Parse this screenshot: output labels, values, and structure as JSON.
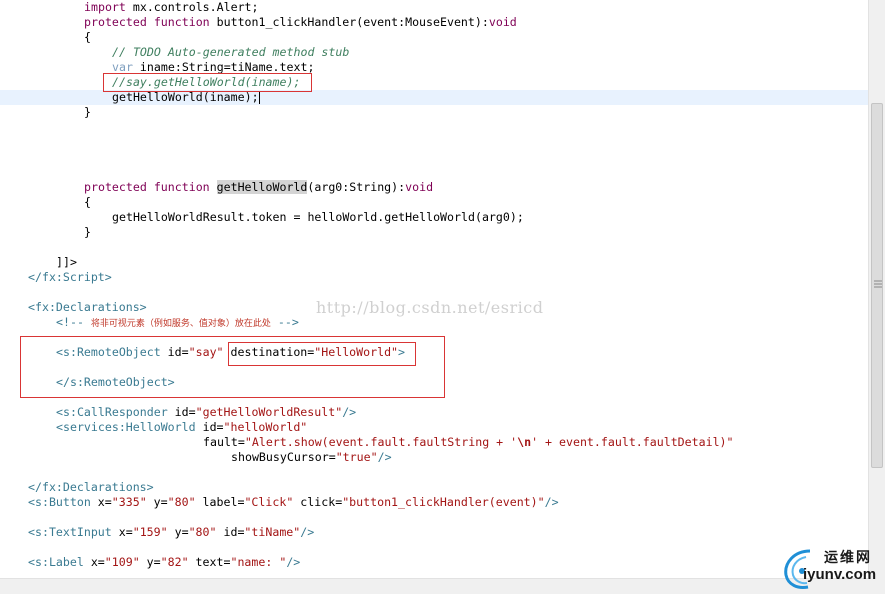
{
  "code": {
    "l1": {
      "kw": "import",
      "rest": " mx.controls.Alert;"
    },
    "l2": {
      "kw1": "protected",
      "kw2": "function",
      "rest": " button1_clickHandler(event:MouseEvent):",
      "ret": "void"
    },
    "l3": "{",
    "l4": "// TODO Auto-generated method stub",
    "l5": {
      "kw": "var",
      "rest": " iname:String=tiName.text;"
    },
    "l6": "//say.getHelloWorld(iname);",
    "l7": "getHelloWorld(iname);",
    "l8": "}",
    "l9": {
      "kw1": "protected",
      "kw2": "function",
      "fn": "getHelloWorld",
      "rest": "(arg0:String):",
      "ret": "void"
    },
    "l10": "{",
    "l11": "getHelloWorldResult.token = helloWorld.getHelloWorld(arg0);",
    "l12": "}",
    "l13": "]]>",
    "l14": "</fx:Script>",
    "l15": "<fx:Declarations>",
    "l16": {
      "open": "<!-- ",
      "text": "将非可视元素（例如服务、值对象）放在此处",
      "close": " -->"
    },
    "l17": {
      "tag": "<s:RemoteObject",
      "a1": " id=",
      "v1": "\"say\"",
      "a2": " destination=",
      "v2": "\"HelloWorld\"",
      "end": ">"
    },
    "l18": "</s:RemoteObject>",
    "l19": {
      "tag": "<s:CallResponder",
      "a1": " id=",
      "v1": "\"getHelloWorldResult\"",
      "end": "/>"
    },
    "l20": {
      "tag": "<services:HelloWorld",
      "a1": " id=",
      "v1": "\"helloWorld\""
    },
    "l21": {
      "a1": "fault=",
      "v1": "\"Alert.show(event.fault.faultString + '",
      "nl": "\\n",
      "v1b": "' + event.fault.faultDetail)\""
    },
    "l22": {
      "a1": "showBusyCursor=",
      "v1": "\"true\"",
      "end": "/>"
    },
    "l23": "</fx:Declarations>",
    "l24": {
      "tag": "<s:Button",
      "a1": " x=",
      "v1": "\"335\"",
      "a2": " y=",
      "v2": "\"80\"",
      "a3": " label=",
      "v3": "\"Click\"",
      "a4": " click=",
      "v4": "\"button1_clickHandler(event)\"",
      "end": "/>"
    },
    "l25": {
      "tag": "<s:TextInput",
      "a1": " x=",
      "v1": "\"159\"",
      "a2": " y=",
      "v2": "\"80\"",
      "a3": " id=",
      "v3": "\"tiName\"",
      "end": "/>"
    },
    "l26": {
      "tag": "<s:Label",
      "a1": " x=",
      "v1": "\"109\"",
      "a2": " y=",
      "v2": "\"82\"",
      "a3": " text=",
      "v3": "\"name: \"",
      "end": "/>"
    }
  },
  "watermark": "http://blog.csdn.net/esricd",
  "logo": {
    "cn": "运维网",
    "url": "iyunv.com"
  },
  "colors": {
    "highlight_line": "#e8f2fe",
    "annotation_box": "#d93535"
  }
}
